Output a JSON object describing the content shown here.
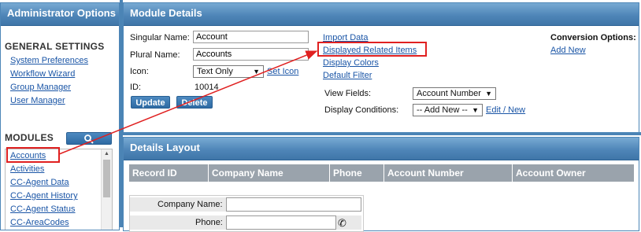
{
  "left_panel": {
    "title": "Administrator Options",
    "general_settings": {
      "heading": "GENERAL SETTINGS",
      "links": [
        "System Preferences",
        "Workflow Wizard",
        "Group Manager",
        "User Manager"
      ]
    },
    "modules": {
      "heading": "MODULES",
      "search_icon": "search-icon",
      "items": [
        "Accounts",
        "Activities",
        "CC-Agent Data",
        "CC-Agent History",
        "CC-Agent Status",
        "CC-AreaCodes"
      ]
    }
  },
  "module_details": {
    "title": "Module Details",
    "singular_label": "Singular Name:",
    "singular_value": "Account",
    "plural_label": "Plural Name:",
    "plural_value": "Accounts",
    "icon_label": "Icon:",
    "icon_value": "Text Only",
    "set_icon": "Set Icon",
    "id_label": "ID:",
    "id_value": "10014",
    "update_label": "Update",
    "delete_label": "Delete",
    "links": [
      "Import Data",
      "Displayed Related Items",
      "Display Colors",
      "Default Filter"
    ],
    "view_fields_label": "View Fields:",
    "view_fields_value": "Account Number",
    "display_conditions_label": "Display Conditions:",
    "display_conditions_value": "-- Add New --",
    "edit_new": "Edit / New",
    "conversion_label": "Conversion Options:",
    "add_new": "Add New"
  },
  "details_layout": {
    "title": "Details Layout",
    "columns": [
      "Record ID",
      "Company Name",
      "Phone",
      "Account Number",
      "Account Owner"
    ],
    "form_fields": [
      {
        "label": "Company Name:",
        "value": ""
      },
      {
        "label": "Phone:",
        "value": ""
      }
    ],
    "phone_icon": "phone-icon"
  },
  "annotation": {
    "color": "#e02020"
  }
}
